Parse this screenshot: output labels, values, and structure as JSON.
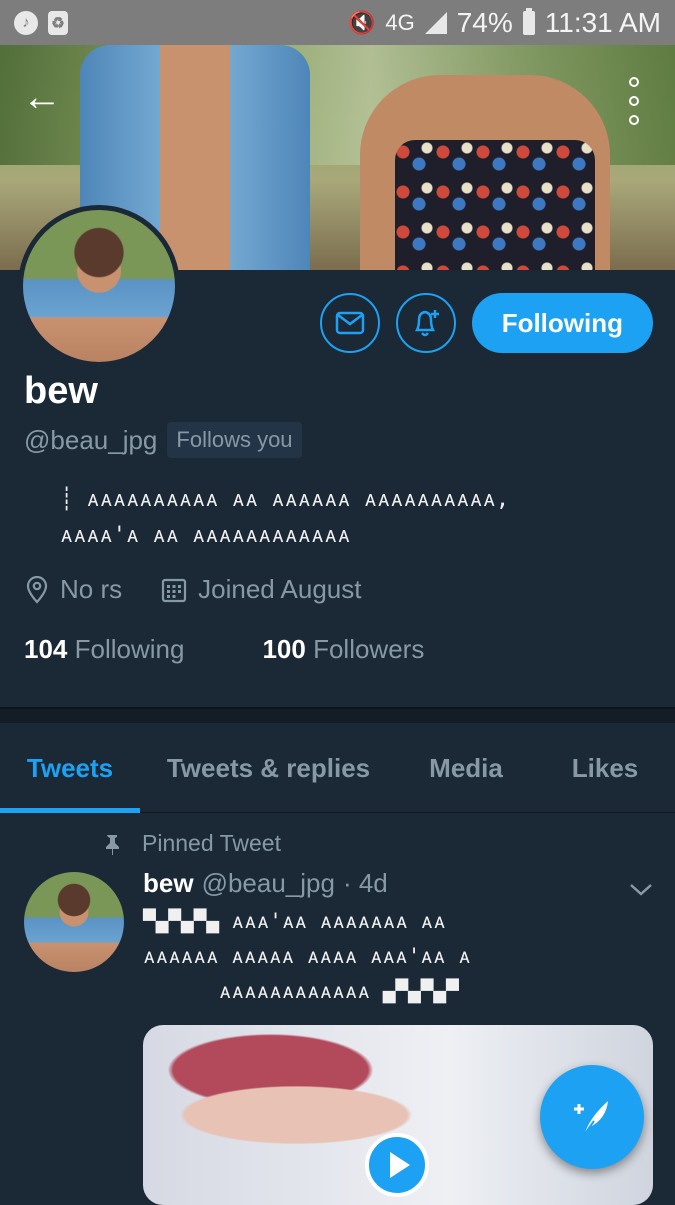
{
  "status_bar": {
    "battery": "74%",
    "time": "11:31 AM",
    "network": "4G",
    "icons": [
      "music-icon",
      "recycle-icon",
      "mute-icon",
      "signal-icon",
      "battery-icon"
    ]
  },
  "profile": {
    "name": "bew",
    "handle": "@beau_jpg",
    "follows_you": "Follows you",
    "follow_button": "Following",
    "bio_line1": "┊ ᴀᴀᴀᴀᴀᴀᴀᴀᴀᴀ ᴀᴀ ᴀᴀᴀᴀᴀᴀ ᴀᴀᴀᴀᴀᴀᴀᴀᴀᴀ,",
    "bio_line2": "ᴀᴀᴀᴀ'ᴀ ᴀᴀ ᴀᴀᴀᴀᴀᴀᴀᴀᴀᴀᴀᴀ",
    "location": "No rs",
    "joined": "Joined August",
    "following_count": "104",
    "following_label": "Following",
    "followers_count": "100",
    "followers_label": "Followers"
  },
  "tabs": [
    {
      "label": "Tweets",
      "active": true
    },
    {
      "label": "Tweets & replies",
      "active": false
    },
    {
      "label": "Media",
      "active": false
    },
    {
      "label": "Likes",
      "active": false
    }
  ],
  "pinned_tweet": {
    "pinned_label": "Pinned Tweet",
    "name": "bew",
    "handle": "@beau_jpg",
    "time": "· 4d",
    "line1": "▀▄▀▄▀▄ ᴀᴀᴀ'ᴀᴀ ᴀᴀᴀᴀᴀᴀᴀ ᴀᴀ",
    "line2": "ᴀᴀᴀᴀᴀᴀ ᴀᴀᴀᴀᴀ ᴀᴀᴀᴀ ᴀᴀᴀ'ᴀᴀ ᴀ",
    "line3": "      ᴀᴀᴀᴀᴀᴀᴀᴀᴀᴀᴀᴀ ▄▀▄▀▄▀"
  },
  "colors": {
    "accent": "#1da1f2",
    "background": "#1b2836",
    "muted": "#8899a6"
  }
}
